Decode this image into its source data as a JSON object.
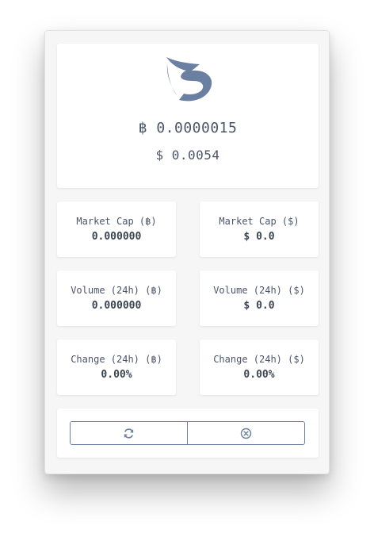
{
  "colors": {
    "accent": "#6b7fa3",
    "text": "#4a5568",
    "panel_bg": "#f6f6f6",
    "card_bg": "#ffffff"
  },
  "hero": {
    "logo_icon": "s-logo-icon",
    "price_btc": "฿ 0.0000015",
    "price_usd": "$ 0.0054"
  },
  "stats": {
    "market_cap_btc": {
      "label": "Market Cap (฿)",
      "value": "0.000000"
    },
    "market_cap_usd": {
      "label": "Market Cap ($)",
      "value": "$ 0.0"
    },
    "volume_btc": {
      "label": "Volume (24h) (฿)",
      "value": "0.000000"
    },
    "volume_usd": {
      "label": "Volume (24h) ($)",
      "value": "$ 0.0"
    },
    "change_btc": {
      "label": "Change (24h) (฿)",
      "value": "0.00%"
    },
    "change_usd": {
      "label": "Change (24h) ($)",
      "value": "0.00%"
    }
  },
  "actions": {
    "refresh_icon": "refresh-icon",
    "close_icon": "close-circle-icon"
  }
}
